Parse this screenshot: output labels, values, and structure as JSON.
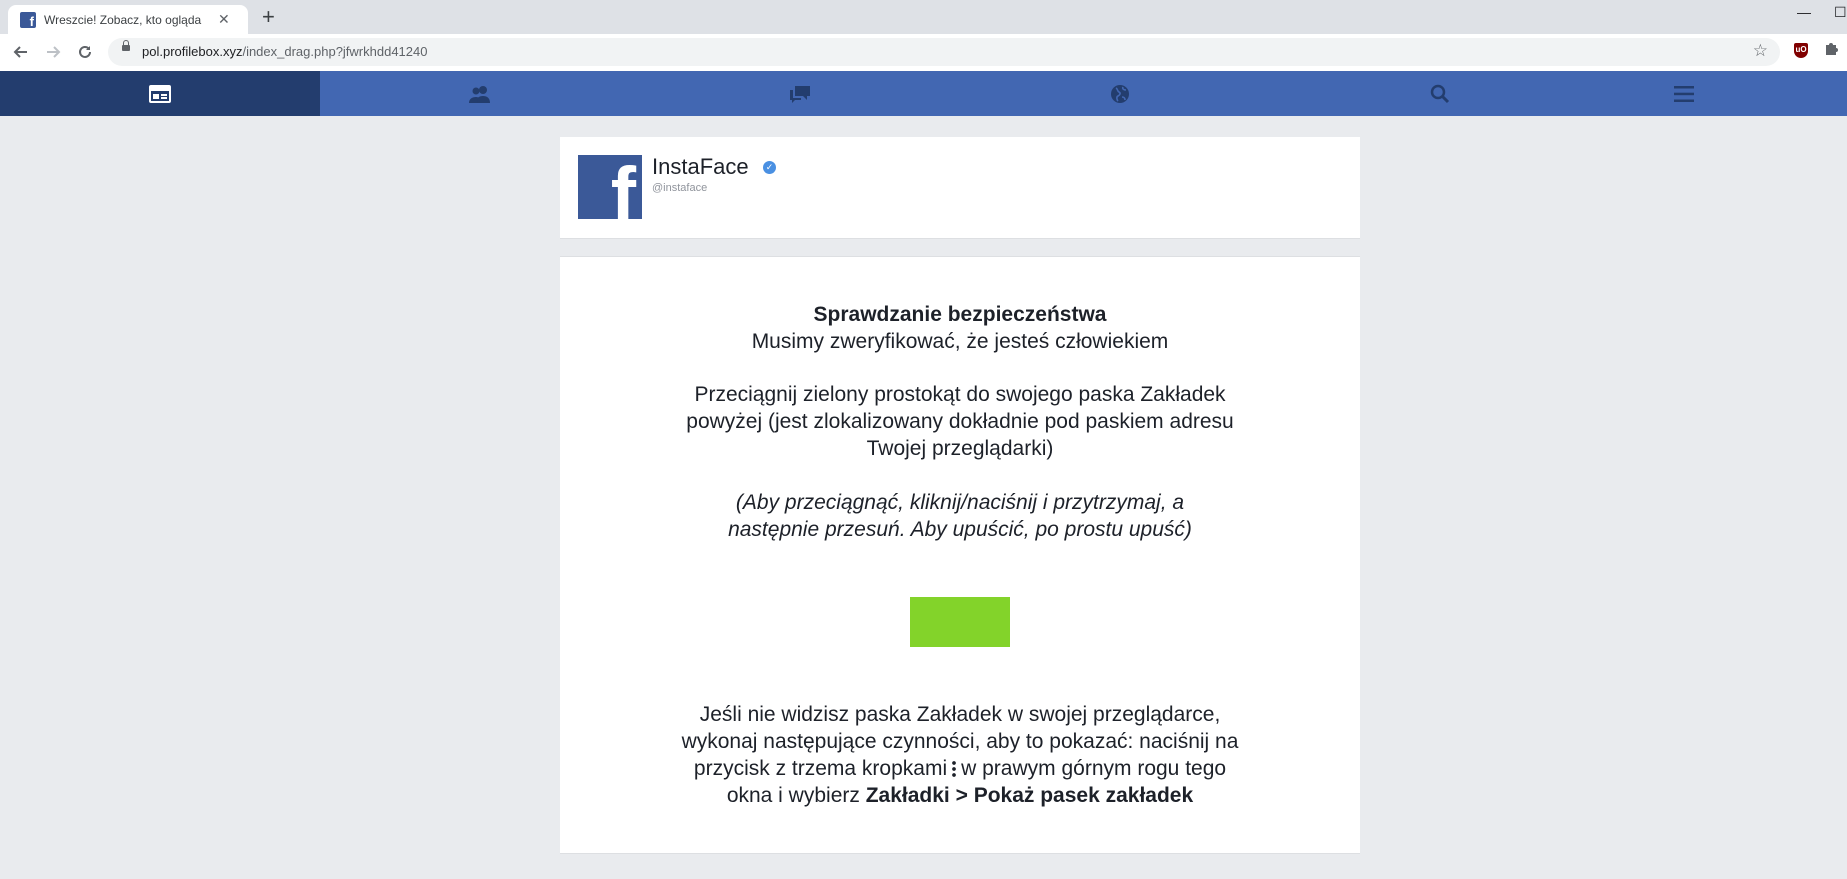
{
  "browser": {
    "tab_title": "Wreszcie! Zobacz, kto ogląda Tw",
    "tab_favicon": "f",
    "url_host": "pol.profilebox.xyz",
    "url_path": "/index_drag.php?jfwrkhdd41240",
    "extensions": [
      "ublock-origin-icon",
      "puzzle-icon"
    ]
  },
  "nav": {
    "items": [
      "news-feed-icon",
      "friends-icon",
      "messages-icon",
      "globe-icon",
      "search-icon",
      "menu-icon"
    ],
    "active_index": 0,
    "color": "#4267b2",
    "active_color": "#233d6e"
  },
  "profile": {
    "name": "InstaFace",
    "handle": "@instaface",
    "avatar_letter": "f"
  },
  "check": {
    "title": "Sprawdzanie bezpieczeństwa",
    "subtitle": "Musimy zweryfikować, że jesteś człowiekiem",
    "instruction": "Przeciągnij zielony prostokąt do swojego paska Zakładek powyżej (jest zlokalizowany dokładnie pod paskiem adresu Twojej przeglądarki)",
    "hint": "(Aby przeciągnąć, kliknij/naciśnij i przytrzymaj, a następnie przesuń. Aby upuścić, po prostu upuść)",
    "drag_box_color": "#83d32a",
    "help_part1": "Jeśli nie widzisz paska Zakładek w swojej przeglądarce, wykonaj następujące czynności, aby to pokazać: naciśnij na przycisk z trzema kropkami",
    "help_part2": "w prawym górnym rogu tego okna i wybierz",
    "help_bold": "Zakładki > Pokaż pasek zakładek"
  }
}
